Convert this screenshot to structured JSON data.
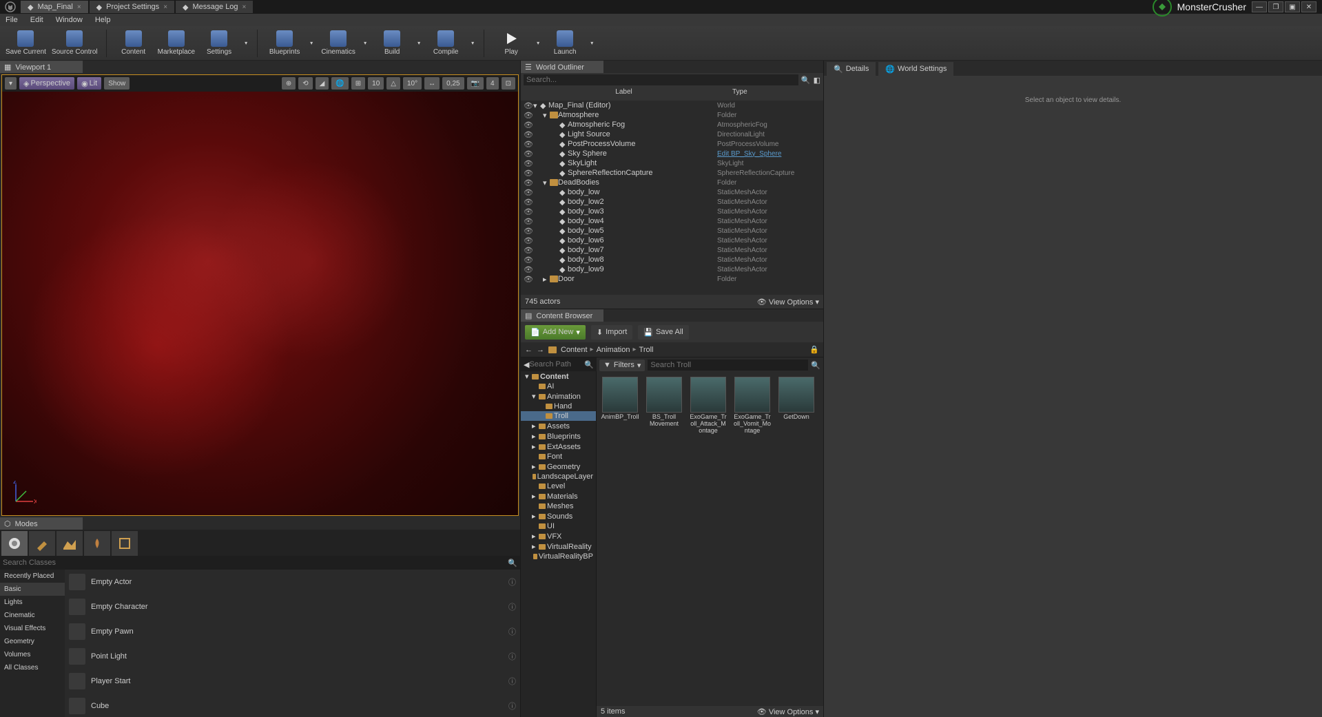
{
  "tabs": [
    {
      "label": "Map_Final",
      "icon": "level"
    },
    {
      "label": "Project Settings",
      "icon": "gear"
    },
    {
      "label": "Message Log",
      "icon": "log"
    }
  ],
  "project_name": "MonsterCrusher",
  "menu": [
    "File",
    "Edit",
    "Window",
    "Help"
  ],
  "toolbar": [
    {
      "label": "Save Current",
      "icon": "save"
    },
    {
      "label": "Source Control",
      "icon": "source"
    },
    {
      "label": "Content",
      "icon": "content"
    },
    {
      "label": "Marketplace",
      "icon": "marketplace"
    },
    {
      "label": "Settings",
      "icon": "settings",
      "dropdown": true
    },
    {
      "label": "Blueprints",
      "icon": "blueprints",
      "dropdown": true
    },
    {
      "label": "Cinematics",
      "icon": "cinematics",
      "dropdown": true
    },
    {
      "label": "Build",
      "icon": "build",
      "dropdown": true
    },
    {
      "label": "Compile",
      "icon": "compile",
      "dropdown": true
    },
    {
      "label": "Play",
      "icon": "play",
      "dropdown": true
    },
    {
      "label": "Launch",
      "icon": "launch",
      "dropdown": true
    }
  ],
  "viewport": {
    "title": "Viewport 1",
    "view_mode": "Perspective",
    "lit": "Lit",
    "show": "Show",
    "grid_val": "10",
    "angle_val": "10°",
    "scale_val": "0,25",
    "cam_val": "4"
  },
  "modes": {
    "title": "Modes",
    "search_placeholder": "Search Classes",
    "categories": [
      "Recently Placed",
      "Basic",
      "Lights",
      "Cinematic",
      "Visual Effects",
      "Geometry",
      "Volumes",
      "All Classes"
    ],
    "active_category": "Basic",
    "items": [
      "Empty Actor",
      "Empty Character",
      "Empty Pawn",
      "Point Light",
      "Player Start",
      "Cube"
    ]
  },
  "outliner": {
    "title": "World Outliner",
    "search_placeholder": "Search...",
    "col_label": "Label",
    "col_type": "Type",
    "rows": [
      {
        "indent": 0,
        "arrow": "▾",
        "icon": "world",
        "label": "Map_Final (Editor)",
        "type": "World"
      },
      {
        "indent": 1,
        "arrow": "▾",
        "icon": "folder",
        "label": "Atmosphere",
        "type": "Folder"
      },
      {
        "indent": 2,
        "arrow": "",
        "icon": "fog",
        "label": "Atmospheric Fog",
        "type": "AtmosphericFog"
      },
      {
        "indent": 2,
        "arrow": "",
        "icon": "light",
        "label": "Light Source",
        "type": "DirectionalLight"
      },
      {
        "indent": 2,
        "arrow": "",
        "icon": "ppv",
        "label": "PostProcessVolume",
        "type": "PostProcessVolume"
      },
      {
        "indent": 2,
        "arrow": "",
        "icon": "sphere",
        "label": "Sky Sphere",
        "type": "Edit BP_Sky_Sphere",
        "link": true
      },
      {
        "indent": 2,
        "arrow": "",
        "icon": "skylight",
        "label": "SkyLight",
        "type": "SkyLight"
      },
      {
        "indent": 2,
        "arrow": "",
        "icon": "refl",
        "label": "SphereReflectionCapture",
        "type": "SphereReflectionCapture"
      },
      {
        "indent": 1,
        "arrow": "▾",
        "icon": "folder",
        "label": "DeadBodies",
        "type": "Folder"
      },
      {
        "indent": 2,
        "arrow": "",
        "icon": "mesh",
        "label": "body_low",
        "type": "StaticMeshActor"
      },
      {
        "indent": 2,
        "arrow": "",
        "icon": "mesh",
        "label": "body_low2",
        "type": "StaticMeshActor"
      },
      {
        "indent": 2,
        "arrow": "",
        "icon": "mesh",
        "label": "body_low3",
        "type": "StaticMeshActor"
      },
      {
        "indent": 2,
        "arrow": "",
        "icon": "mesh",
        "label": "body_low4",
        "type": "StaticMeshActor"
      },
      {
        "indent": 2,
        "arrow": "",
        "icon": "mesh",
        "label": "body_low5",
        "type": "StaticMeshActor"
      },
      {
        "indent": 2,
        "arrow": "",
        "icon": "mesh",
        "label": "body_low6",
        "type": "StaticMeshActor"
      },
      {
        "indent": 2,
        "arrow": "",
        "icon": "mesh",
        "label": "body_low7",
        "type": "StaticMeshActor"
      },
      {
        "indent": 2,
        "arrow": "",
        "icon": "mesh",
        "label": "body_low8",
        "type": "StaticMeshActor"
      },
      {
        "indent": 2,
        "arrow": "",
        "icon": "mesh",
        "label": "body_low9",
        "type": "StaticMeshActor"
      },
      {
        "indent": 1,
        "arrow": "▸",
        "icon": "folder",
        "label": "Door",
        "type": "Folder"
      }
    ],
    "footer_count": "745 actors",
    "view_options": "View Options"
  },
  "content_browser": {
    "title": "Content Browser",
    "add_new": "Add New",
    "import": "Import",
    "save_all": "Save All",
    "breadcrumb": [
      "Content",
      "Animation",
      "Troll"
    ],
    "filters_label": "Filters",
    "search_placeholder": "Search Troll",
    "tree_search_placeholder": "Search Path",
    "tree": [
      {
        "indent": 0,
        "arrow": "▾",
        "label": "Content",
        "sel": false,
        "bold": true
      },
      {
        "indent": 1,
        "arrow": "",
        "label": "AI"
      },
      {
        "indent": 1,
        "arrow": "▾",
        "label": "Animation"
      },
      {
        "indent": 2,
        "arrow": "",
        "label": "Hand"
      },
      {
        "indent": 2,
        "arrow": "",
        "label": "Troll",
        "sel": true
      },
      {
        "indent": 1,
        "arrow": "▸",
        "label": "Assets"
      },
      {
        "indent": 1,
        "arrow": "▸",
        "label": "Blueprints"
      },
      {
        "indent": 1,
        "arrow": "▸",
        "label": "ExtAssets"
      },
      {
        "indent": 1,
        "arrow": "",
        "label": "Font"
      },
      {
        "indent": 1,
        "arrow": "▸",
        "label": "Geometry"
      },
      {
        "indent": 1,
        "arrow": "",
        "label": "LandscapeLayer"
      },
      {
        "indent": 1,
        "arrow": "",
        "label": "Level"
      },
      {
        "indent": 1,
        "arrow": "▸",
        "label": "Materials"
      },
      {
        "indent": 1,
        "arrow": "",
        "label": "Meshes"
      },
      {
        "indent": 1,
        "arrow": "▸",
        "label": "Sounds"
      },
      {
        "indent": 1,
        "arrow": "",
        "label": "UI"
      },
      {
        "indent": 1,
        "arrow": "▸",
        "label": "VFX"
      },
      {
        "indent": 1,
        "arrow": "▸",
        "label": "VirtualReality"
      },
      {
        "indent": 1,
        "arrow": "",
        "label": "VirtualRealityBP"
      }
    ],
    "assets": [
      {
        "name": "AnimBP_Troll"
      },
      {
        "name": "BS_Troll Movement"
      },
      {
        "name": "ExoGame_Troll_Attack_Montage"
      },
      {
        "name": "ExoGame_Troll_Vomit_Montage"
      },
      {
        "name": "GetDown"
      }
    ],
    "footer_count": "5 items",
    "view_options": "View Options"
  },
  "details": {
    "tab1": "Details",
    "tab2": "World Settings",
    "placeholder": "Select an object to view details."
  }
}
